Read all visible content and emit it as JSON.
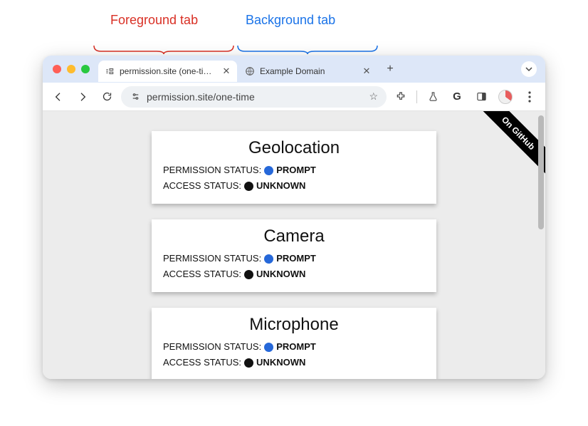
{
  "annotations": {
    "foreground": "Foreground tab",
    "background": "Background tab"
  },
  "tabs": [
    {
      "title": "permission.site (one-time)",
      "active": true
    },
    {
      "title": "Example Domain",
      "active": false
    }
  ],
  "url": "permission.site/one-time",
  "ribbon": "On GitHub",
  "cards": [
    {
      "title": "Geolocation",
      "permission_label": "PERMISSION STATUS:",
      "permission_value": "PROMPT",
      "access_label": "ACCESS STATUS:",
      "access_value": "UNKNOWN"
    },
    {
      "title": "Camera",
      "permission_label": "PERMISSION STATUS:",
      "permission_value": "PROMPT",
      "access_label": "ACCESS STATUS:",
      "access_value": "UNKNOWN"
    },
    {
      "title": "Microphone",
      "permission_label": "PERMISSION STATUS:",
      "permission_value": "PROMPT",
      "access_label": "ACCESS STATUS:",
      "access_value": "UNKNOWN"
    }
  ]
}
